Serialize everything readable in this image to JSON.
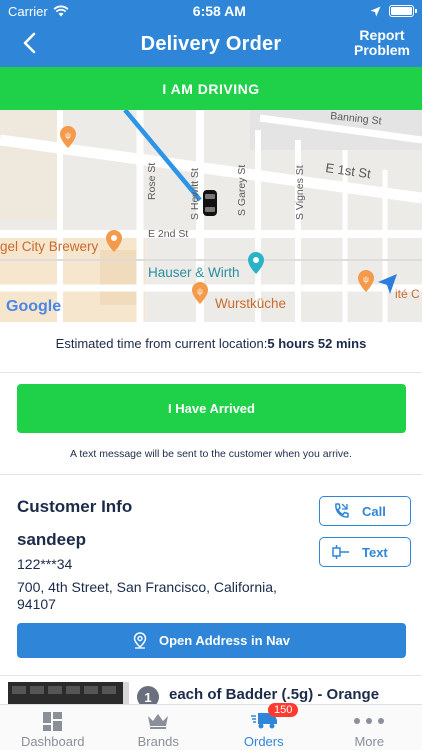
{
  "status_bar": {
    "carrier": "Carrier",
    "time": "6:58 AM"
  },
  "header": {
    "title": "Delivery Order",
    "report_line1": "Report",
    "report_line2": "Problem"
  },
  "driving_bar": {
    "label": "I AM DRIVING"
  },
  "map": {
    "streets": [
      "Banning St",
      "E 1st St",
      "E 2nd St",
      "Rose St",
      "S Hewitt St",
      "S Garey St",
      "S Vignes St"
    ],
    "places": [
      "gel City Brewery",
      "Hauser & Wirth",
      "Wurstküche",
      "ité C"
    ],
    "attribution": "Google"
  },
  "eta": {
    "label": "Estimated time from current location:",
    "value": "5 hours 52 mins"
  },
  "arrived": {
    "label": "I Have Arrived",
    "note": "A text message will be sent to the customer when you arrive."
  },
  "customer": {
    "section_title": "Customer Info",
    "name": "sandeep",
    "phone": "122***34",
    "address": "700, 4th Street, San Francisco, California, 94107",
    "call_label": "Call",
    "text_label": "Text",
    "nav_label": "Open Address in Nav"
  },
  "order_item": {
    "quantity": "1",
    "name": "each of Badder (.5g) - Orange"
  },
  "tabs": [
    {
      "label": "Dashboard",
      "icon": "dashboard-icon",
      "active": false
    },
    {
      "label": "Brands",
      "icon": "crown-icon",
      "active": false
    },
    {
      "label": "Orders",
      "icon": "truck-icon",
      "active": true,
      "badge": "150"
    },
    {
      "label": "More",
      "icon": "more-icon",
      "active": false
    }
  ],
  "colors": {
    "primary": "#2f86d8",
    "success": "#1fd148",
    "text": "#1c2b4a",
    "badge": "#ff3b30"
  }
}
